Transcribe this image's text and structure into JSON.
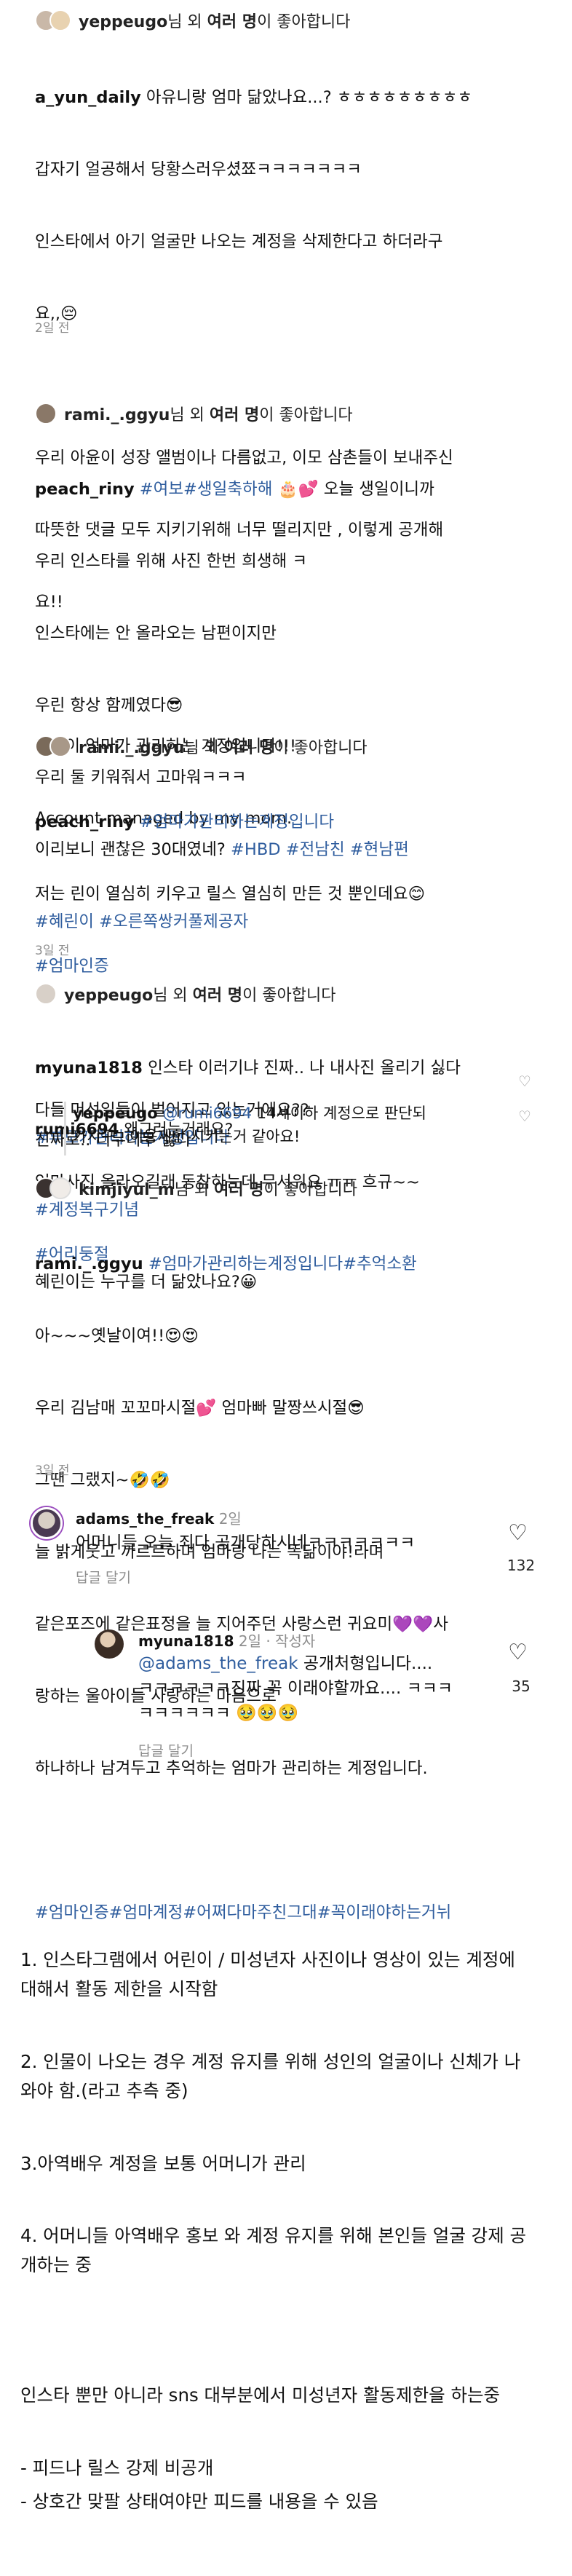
{
  "posts": [
    {
      "liked_user": "yeppeugo",
      "liked_mid": "님 외 ",
      "liked_bold": "여러 명",
      "liked_end": "이 좋아합니다",
      "avatar_colors": [
        "#c9b8a8",
        "#e8d2b0"
      ],
      "caption_user": "a_yun_daily",
      "caption_lines": [
        " 아유니랑 엄마 닮았나요...? ㅎㅎㅎㅎㅎㅎㅎㅎㅎ",
        "갑자기 얼공해서 당황스러우셨쬬ㅋㅋㅋㅋㅋㅋㅋ",
        "인스타에서 아기 얼굴만 나오는 계정을 삭제한다고 하더라구",
        "요,,😔",
        "",
        "우리 아윤이 성장 앨범이나 다름없고, 이모 삼촌들이 보내주신",
        "따뜻한 댓글 모두 지키기위해 너무 떨리지만 , 이렇게 공개해",
        "요!!",
        "",
        "아윤이 엄마가 관리하는 계정입니다!!!",
        "Account managed by my mom."
      ],
      "time": "2일 전"
    },
    {
      "liked_user": "rami._.ggyu",
      "liked_mid": "님 외 ",
      "liked_bold": "여러 명",
      "liked_end": "이 좋아합니다",
      "avatar_colors": [
        "#8a7868"
      ],
      "caption_user": "peach_riny",
      "caption_tag1": " #여보#생일축하해",
      "caption_line1_end": " 🎂💕 오늘 생일이니까",
      "caption_lines": [
        "우리 인스타를 위해 사진 한번 희생해 ㅋ",
        "인스타에는 안 올라오는 남편이지만",
        "우린 항상 함께였다😎",
        "우리 둘 키워줘서 고마워ㅋㅋㅋ",
        "이리보니 괜찮은 30대였네?"
      ],
      "caption_tag_end": " #HBD #전남친 #현남편",
      "caption_tag_line": "#혜린이 #오른쪽쌍커풀제공자",
      "caption_tags2": [
        "#부모가관리하는계정입니다",
        "#계정복구기념"
      ],
      "caption_last": "혜린이는 누구를 더 닮았나요?😀"
    },
    {
      "liked_user": "rami._.ggyu",
      "liked_mid": "님 외 ",
      "liked_bold": "여러 명",
      "liked_end": "이 좋아합니다",
      "avatar_colors": [
        "#7a6a5a",
        "#a89888"
      ],
      "caption_user": "peach_riny",
      "caption_tag1": " #엄마가관리하는계정입니다",
      "caption_lines": [
        "저는 린이 열심히 키우고 릴스 열심히 만든 것 뿐인데요😊"
      ],
      "caption_tag_line": "#엄마인증",
      "caption_lines2": [
        "다들 머선일들이 벌어지고 있는거에요??",
        "엄마사진 올라오길래 동참하는데 무서워요 ㅠㅠ 흐규~~"
      ],
      "caption_tag_end": "#어리둥절",
      "time": "3일 전"
    },
    {
      "liked_user": "yeppeugo",
      "liked_mid": "님 외 ",
      "liked_bold": "여러 명",
      "liked_end": "이 좋아합니다",
      "avatar_colors": [
        "#d8d0c8"
      ],
      "caption_user": "myuna1818",
      "caption_lines": [
        " 인스타 이러기냐 진짜.. 나 내사진 올리기 싫다",
        "진짜로.. 너무너무 싫다"
      ],
      "comment1_user": "rumi6694",
      "comment1_text": " 왜그러는거래요?",
      "reply_user": "yeppeugo",
      "reply_mention": " @rumi6694",
      "reply_text1": " 14세이하 계정으로 판단되",
      "reply_text2": "가지구.. 이용제한 시키는거 같아요!"
    },
    {
      "liked_user": "kimjiyul_m",
      "liked_mid": "님 외 ",
      "liked_bold": "여러 명",
      "liked_end": "이 좋아합니다",
      "avatar_colors": [
        "#3a3230",
        "#f0ece8"
      ],
      "caption_user": "rami._.ggyu",
      "caption_tag1": " #엄마가관리하는계정입니다#추억소환",
      "caption_lines": [
        "아~~~옛날이여!!😍😍",
        "우리 김남매 꼬꼬마시절💕 엄마빠 말짱쓰시절😎",
        "그땐 그랬지~🤣🤣",
        "늘 밝게웃고 까르르하며 엄마랑 나는 똑닮이야!라며",
        "같은포즈에 같은표정을 늘 지어주던 사랑스런 귀요미💜💜사",
        "랑하는 울아이들 사랑하는 마음으로",
        "하나하나 남겨두고 추억하는 엄마가 관리하는 계정입니다."
      ],
      "caption_tag_line": "#엄마인증#엄마계정#어쩌다마주친그대#꼭이래야하는거뉘",
      "time": "3일 전"
    }
  ],
  "comments": {
    "c1": {
      "user": "adams_the_freak",
      "meta": " 2일",
      "text": "어머니들 오늘 죄다 공개당하시네ㅋㅋㅋㅋㅋㅋㅋ",
      "reply_label": "답글 달기",
      "likes": "132"
    },
    "c2": {
      "user": "myuna1818",
      "meta": " 2일 · 작성자",
      "mention": "@adams_the_freak",
      "text1": " 공개처형입니다....",
      "text2": "ㅋㅋㅋㅋㅋㅋ진짜 꼭 이래야할까요.... ㅋㅋㅋ",
      "text3": "ㅋㅋㅋㅋㅋㅋ 🥹🥹🥹",
      "reply_label": "답글 달기",
      "likes": "35"
    }
  },
  "notes": {
    "n1a": "1. 인스타그램에서 어린이 / 미성년자 사진이나 영상이 있는 계정에",
    "n1b": "대해서 활동 제한을 시작함",
    "n2a": "2. 인물이 나오는 경우 계정 유지를 위해 성인의 얼굴이나 신체가 나",
    "n2b": "와야 함.(라고 추측 중)",
    "n3": "3.아역배우 계정을 보통 어머니가 관리",
    "n4a": "4. 어머니들 아역배우 홍보 와 계정 유지를 위해 본인들 얼굴 강제 공",
    "n4b": "개하는 중",
    "n5": "인스타 뿐만 아니라 sns 대부분에서 미성년자 활동제한을 하는중",
    "n6": "- 피드나 릴스 강제 비공개",
    "n7": "- 상호간 맞팔 상태여야만 피드를 내용을 수 있음"
  }
}
